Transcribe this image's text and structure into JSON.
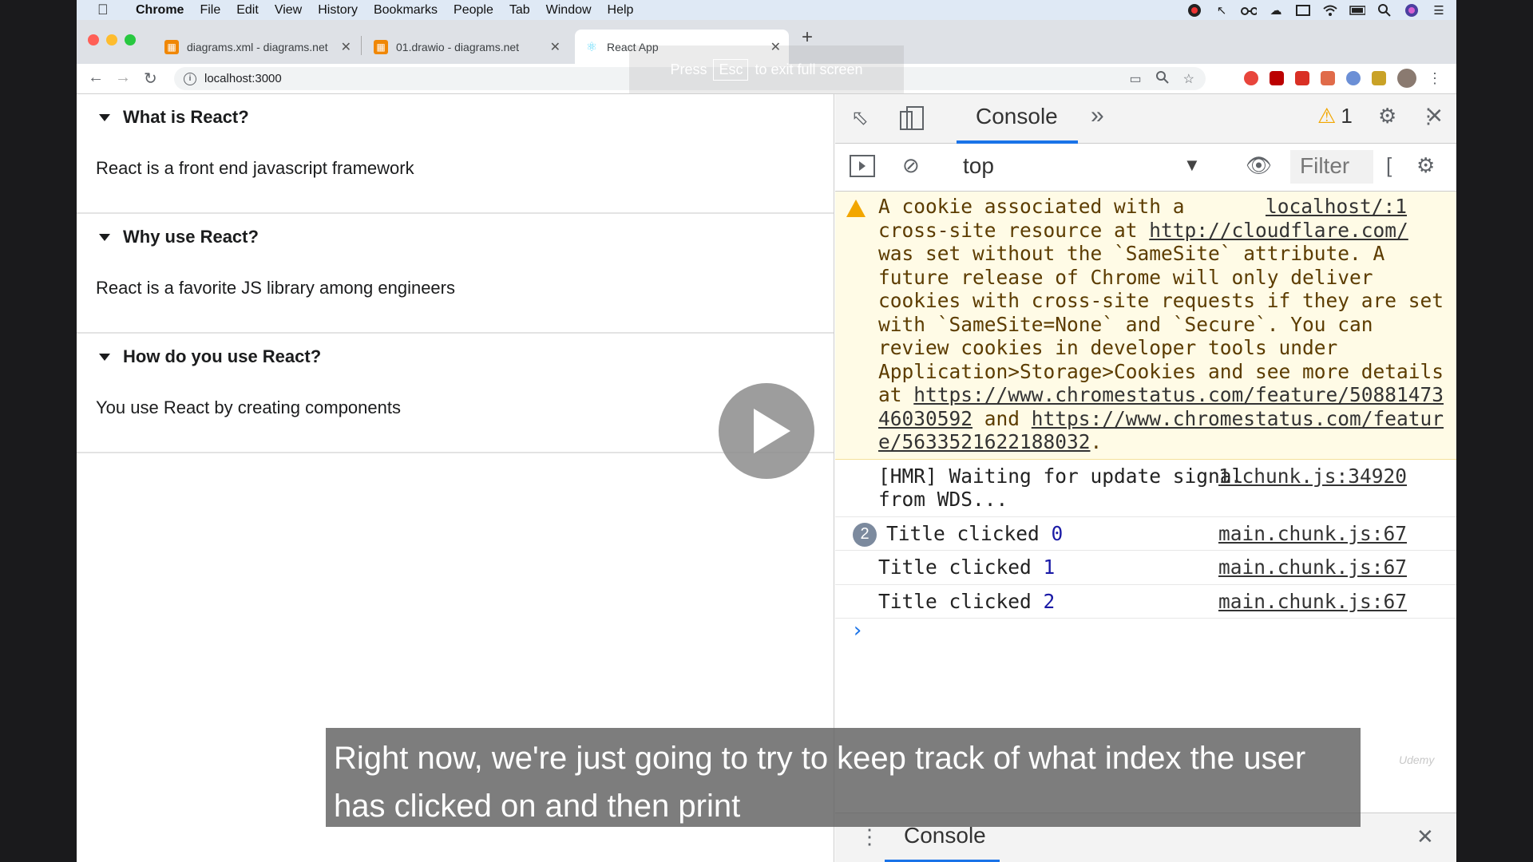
{
  "menubar": {
    "app": "Chrome",
    "items": [
      "File",
      "Edit",
      "View",
      "History",
      "Bookmarks",
      "People",
      "Tab",
      "Window",
      "Help"
    ]
  },
  "tabs": [
    {
      "title": "diagrams.xml - diagrams.net"
    },
    {
      "title": "01.drawio - diagrams.net"
    },
    {
      "title": "React App"
    }
  ],
  "address": {
    "url": "localhost:3000"
  },
  "fullscreen_toast": {
    "press": "Press",
    "key": "Esc",
    "rest": "to exit full screen"
  },
  "accordion": [
    {
      "title": "What is React?",
      "content": "React is a front end javascript framework"
    },
    {
      "title": "Why use React?",
      "content": "React is a favorite JS library among engineers"
    },
    {
      "title": "How do you use React?",
      "content": "You use React by creating components"
    }
  ],
  "devtools": {
    "tab": "Console",
    "warning_count": "1",
    "context": "top",
    "filter_placeholder": "Filter",
    "drawer_tab": "Console",
    "warning": {
      "source": "localhost/:1",
      "line1": "A cookie associated with a",
      "link1": "http://cloudflare.com/",
      "pre_link1": "cross-site resource at ",
      "body": "was set without the `SameSite` attribute. A future release of Chrome will only deliver cookies with cross-site requests if they are set with `SameSite=None` and `Secure`. You can review cookies in developer tools under Application>Storage>Cookies and see more details at ",
      "link2": "https://www.chromestatus.com/feature/5088147346030592",
      "and": " and ",
      "link3": "https://www.chromestatus.com/feature/5633521622188032",
      "end": "."
    },
    "messages": [
      {
        "text": "[HMR] Waiting for update signal from WDS...",
        "source": "1.chunk.js:34920"
      },
      {
        "text": "Title clicked",
        "value": "0",
        "count": "2",
        "source": "main.chunk.js:67"
      },
      {
        "text": "Title clicked",
        "value": "1",
        "source": "main.chunk.js:67"
      },
      {
        "text": "Title clicked",
        "value": "2",
        "source": "main.chunk.js:67"
      }
    ]
  },
  "watermark": "Udemy",
  "caption": "Right now, we're just going to try to keep track of what index the user has clicked on and then print"
}
